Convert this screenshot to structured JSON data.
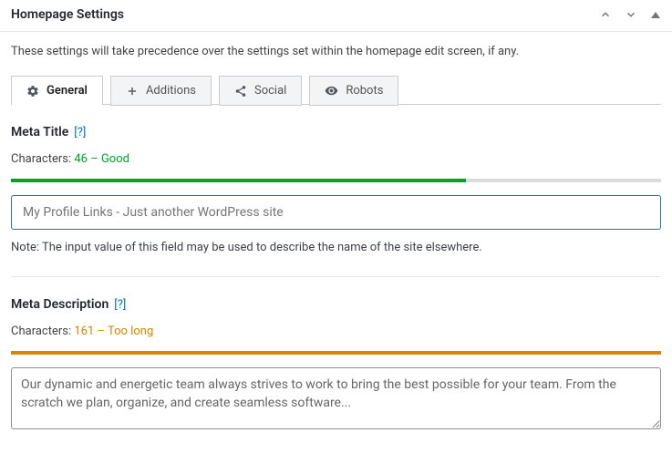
{
  "header": {
    "title": "Homepage Settings"
  },
  "intro": "These settings will take precedence over the settings set within the homepage edit screen, if any.",
  "tabs": [
    {
      "label": "General"
    },
    {
      "label": "Additions"
    },
    {
      "label": "Social"
    },
    {
      "label": "Robots"
    }
  ],
  "meta_title": {
    "label": "Meta Title",
    "help": "[?]",
    "chars_label": "Characters: ",
    "chars_value": "46 – Good",
    "placeholder": "My Profile Links - Just another WordPress site",
    "value": "",
    "note": "Note: The input value of this field may be used to describe the name of the site elsewhere."
  },
  "meta_description": {
    "label": "Meta Description",
    "help": "[?]",
    "chars_label": "Characters: ",
    "chars_value": "161 – Too long",
    "value": "Our dynamic and energetic team always strives to work to bring the best possible for your team. From the scratch we plan, organize, and create seamless software..."
  }
}
